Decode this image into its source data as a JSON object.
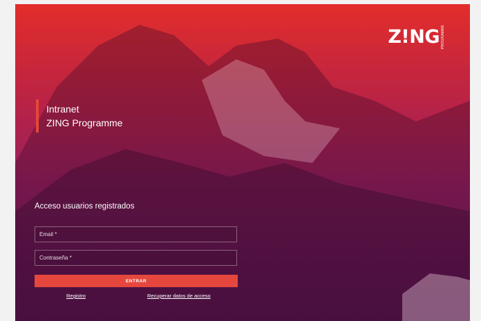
{
  "brand": {
    "logo_text": "Z!NG",
    "logo_subtext": "PROGRAMME"
  },
  "intro": {
    "line1": "Intranet",
    "line2": "ZING Programme"
  },
  "login": {
    "title": "Acceso usuarios registrados",
    "email_placeholder": "Email *",
    "password_placeholder": "Contraseña *",
    "submit_label": "ENTRAR"
  },
  "links": {
    "register": "Registro",
    "recover": "Recuperar datos de acceso"
  },
  "colors": {
    "accent": "#e5473e",
    "overlay_top": "#e82e2a",
    "overlay_bottom": "#6e1a68"
  }
}
